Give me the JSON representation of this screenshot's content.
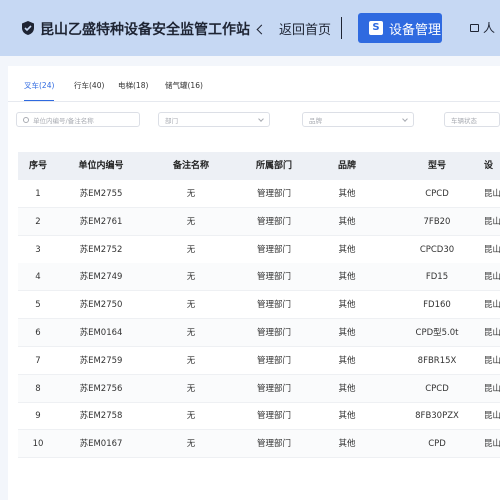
{
  "header": {
    "title": "昆山乙盛特种设备安全监管工作站",
    "back_label": "返回首页",
    "device_mgmt_label": "设备管理",
    "extra_label": "人",
    "colors": {
      "bar": "#c6d8f3",
      "accent": "#2f6ae0"
    }
  },
  "tabs": [
    {
      "label": "叉车(24)",
      "active": true
    },
    {
      "label": "行车(40)",
      "active": false
    },
    {
      "label": "电梯(18)",
      "active": false
    },
    {
      "label": "储气罐(16)",
      "active": false
    }
  ],
  "filters": {
    "search_placeholder": "单位内编号/备注名称",
    "department_placeholder": "部门",
    "brand_placeholder": "品牌",
    "status_placeholder": "车辆状态"
  },
  "table": {
    "columns": [
      "序号",
      "单位内编号",
      "备注名称",
      "所属部门",
      "品牌",
      "型号",
      "设"
    ],
    "rows": [
      [
        "1",
        "苏EM2755",
        "无",
        "管理部门",
        "其他",
        "CPCD",
        "昆山市"
      ],
      [
        "2",
        "苏EM2761",
        "无",
        "管理部门",
        "其他",
        "7FB20",
        "昆山市"
      ],
      [
        "3",
        "苏EM2752",
        "无",
        "管理部门",
        "其他",
        "CPCD30",
        "昆山市"
      ],
      [
        "4",
        "苏EM2749",
        "无",
        "管理部门",
        "其他",
        "FD15",
        "昆山市"
      ],
      [
        "5",
        "苏EM2750",
        "无",
        "管理部门",
        "其他",
        "FD160",
        "昆山市"
      ],
      [
        "6",
        "苏EM0164",
        "无",
        "管理部门",
        "其他",
        "CPD型5.0t",
        "昆山市"
      ],
      [
        "7",
        "苏EM2759",
        "无",
        "管理部门",
        "其他",
        "8FBR15X",
        "昆山市"
      ],
      [
        "8",
        "苏EM2756",
        "无",
        "管理部门",
        "其他",
        "CPCD",
        "昆山市"
      ],
      [
        "9",
        "苏EM2758",
        "无",
        "管理部门",
        "其他",
        "8FB30PZX",
        "昆山市"
      ],
      [
        "10",
        "苏EM0167",
        "无",
        "管理部门",
        "其他",
        "CPD",
        "昆山市"
      ]
    ]
  }
}
